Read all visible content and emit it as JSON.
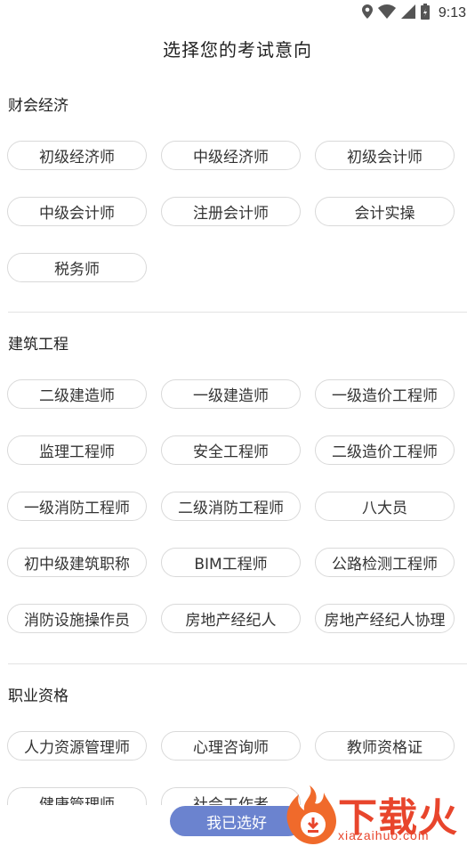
{
  "status": {
    "time": "9:13"
  },
  "title": "选择您的考试意向",
  "sections": [
    {
      "title": "财会经济",
      "items": [
        "初级经济师",
        "中级经济师",
        "初级会计师",
        "中级会计师",
        "注册会计师",
        "会计实操",
        "税务师"
      ]
    },
    {
      "title": "建筑工程",
      "items": [
        "二级建造师",
        "一级建造师",
        "一级造价工程师",
        "监理工程师",
        "安全工程师",
        "二级造价工程师",
        "一级消防工程师",
        "二级消防工程师",
        "八大员",
        "初中级建筑职称",
        "BIM工程师",
        "公路检测工程师",
        "消防设施操作员",
        "房地产经纪人",
        "房地产经纪人协理"
      ]
    },
    {
      "title": "职业资格",
      "items": [
        "人力资源管理师",
        "心理咨询师",
        "教师资格证",
        "健康管理师",
        "社会工作者"
      ]
    }
  ],
  "confirm_button": "我已选好",
  "watermark": {
    "brand": "下载火",
    "url": "xiazaihuo.com"
  },
  "colors": {
    "accent": "#6b83cf",
    "watermark": "#e8452c",
    "chip_border": "#d9d9d9"
  }
}
